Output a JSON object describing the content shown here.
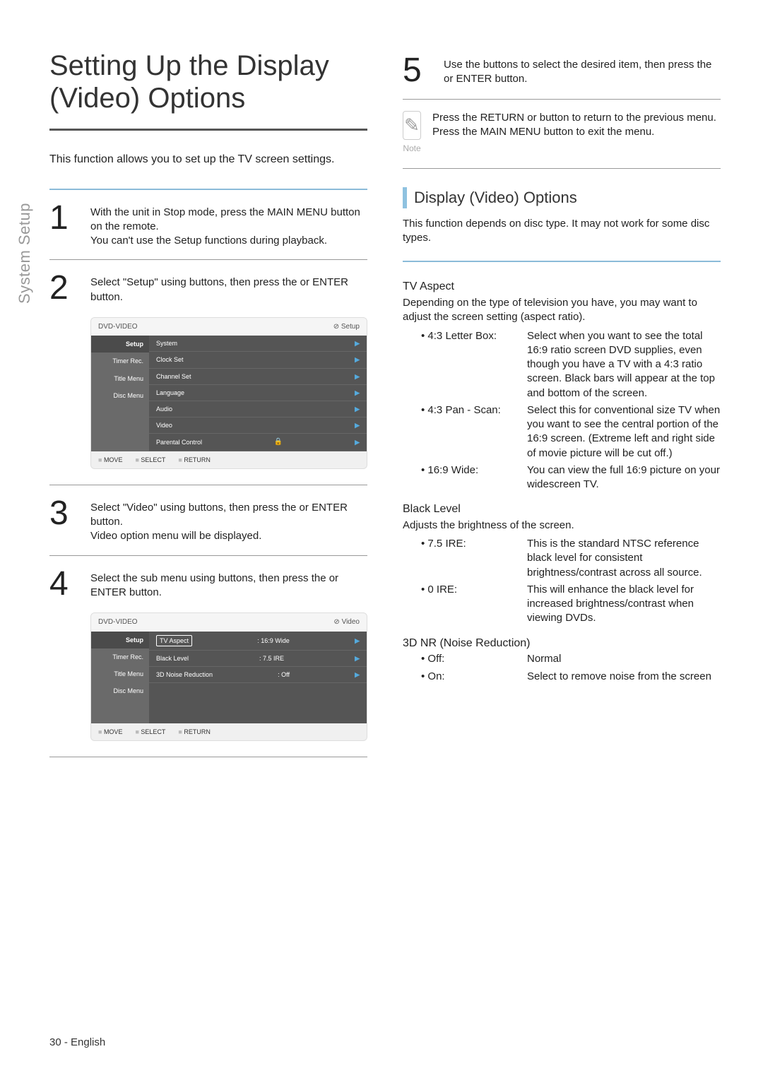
{
  "sideLabel": "System Setup",
  "title": "Setting Up the Display (Video) Options",
  "intro": "This function allows you to set up the TV screen settings.",
  "steps": {
    "s1": {
      "num": "1",
      "lines": [
        "With the unit in Stop mode, press the MAIN MENU button on the remote.",
        "You can't use the Setup functions during playback."
      ]
    },
    "s2": {
      "num": "2",
      "lines": [
        "Select \"Setup\" using          buttons, then press the     or ENTER button."
      ]
    },
    "s3": {
      "num": "3",
      "lines": [
        "Select \"Video\" using           buttons, then press the     or ENTER button.",
        "Video option menu will be displayed."
      ]
    },
    "s4": {
      "num": "4",
      "lines": [
        "Select the sub menu using            buttons, then press the     or ENTER button."
      ]
    },
    "s5": {
      "num": "5",
      "lines": [
        "Use the             buttons to select the desired item, then press the     or ENTER button."
      ]
    }
  },
  "note": "Press the RETURN or        button to return to the previous menu. Press the MAIN MENU button to exit the menu.",
  "noteLabel": "Note",
  "menu1": {
    "title": "DVD-VIDEO",
    "badge": "Setup",
    "side": [
      "Setup",
      "Timer Rec.",
      "Title Menu",
      "Disc Menu"
    ],
    "rows": [
      "System",
      "Clock Set",
      "Channel Set",
      "Language",
      "Audio",
      "Video",
      "Parental Control"
    ],
    "foot": [
      "MOVE",
      "SELECT",
      "RETURN"
    ]
  },
  "menu2": {
    "title": "DVD-VIDEO",
    "badge": "Video",
    "side": [
      "Setup",
      "Timer Rec.",
      "Title Menu",
      "Disc Menu"
    ],
    "rows": [
      {
        "k": "TV Aspect",
        "v": ": 16:9 Wide",
        "sel": true
      },
      {
        "k": "Black Level",
        "v": ": 7.5 IRE"
      },
      {
        "k": "3D Noise Reduction",
        "v": ": Off"
      }
    ],
    "foot": [
      "MOVE",
      "SELECT",
      "RETURN"
    ]
  },
  "rightTitle": "Display (Video) Options",
  "rightDesc": "This function depends on disc type. It may not work for some disc types.",
  "tvAspect": {
    "h": "TV Aspect",
    "d": "Depending on the type of television you have, you may want to adjust the screen setting (aspect ratio).",
    "opts": [
      {
        "k": "4:3 Letter  Box:",
        "v": "Select when you want to see the total 16:9 ratio screen DVD supplies, even though you have a TV with a 4:3 ratio screen. Black bars will appear at the top and bottom of the screen."
      },
      {
        "k": "4:3 Pan - Scan:",
        "v": "Select this for conventional size TV when you want to see the central portion of the 16:9 screen. (Extreme left and right side of movie picture will be cut off.)"
      },
      {
        "k": "16:9 Wide:",
        "v": "You can view the full 16:9 picture on your widescreen TV."
      }
    ]
  },
  "blackLevel": {
    "h": "Black Level",
    "d": "Adjusts the brightness of the screen.",
    "opts": [
      {
        "k": "7.5 IRE:",
        "v": "This is the standard NTSC reference black level for consistent brightness/contrast across all source."
      },
      {
        "k": "0 IRE:",
        "v": "This will  enhance the black level for increased brightness/contrast when viewing DVDs."
      }
    ]
  },
  "nr": {
    "h": "3D NR (Noise Reduction)",
    "opts": [
      {
        "k": "Off:",
        "v": "Normal"
      },
      {
        "k": "On:",
        "v": "Select to remove noise from the screen"
      }
    ]
  },
  "footer": "30 - English"
}
